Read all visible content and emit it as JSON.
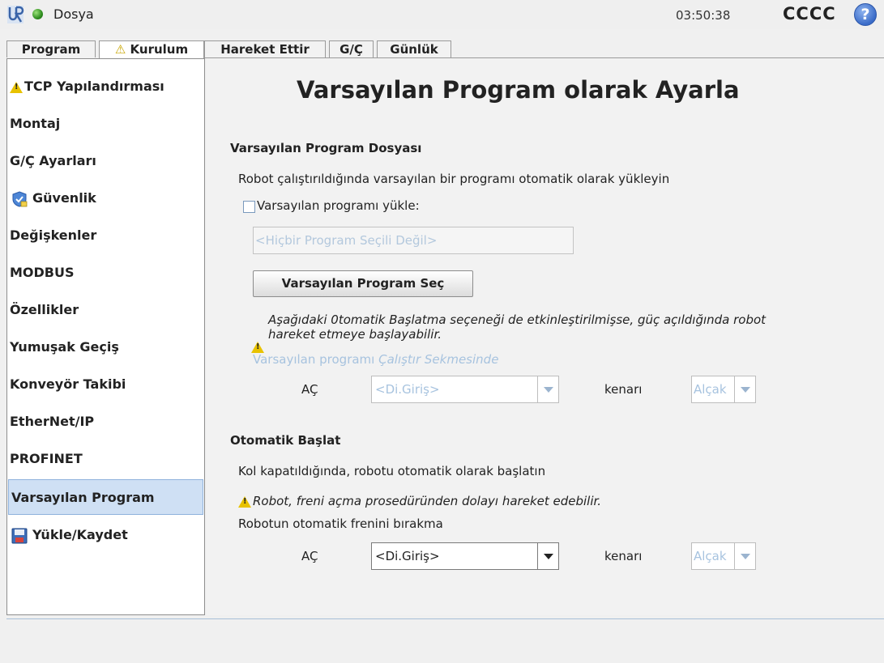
{
  "topbar": {
    "file_menu": "Dosya",
    "time": "03:50:38",
    "robot_name": "CCCC",
    "help_symbol": "?"
  },
  "tabs": [
    {
      "label": "Program",
      "warning": false
    },
    {
      "label": "Kurulum",
      "warning": true,
      "active": true
    },
    {
      "label": "Hareket Ettir",
      "warning": false
    },
    {
      "label": "G/Ç",
      "warning": false
    },
    {
      "label": "Günlük",
      "warning": false
    }
  ],
  "sidebar": {
    "items": [
      {
        "label": "TCP Yapılandırması",
        "icon": "warning-icon"
      },
      {
        "label": "Montaj"
      },
      {
        "label": "G/Ç Ayarları"
      },
      {
        "label": "Güvenlik",
        "icon": "shield-icon"
      },
      {
        "label": "Değişkenler"
      },
      {
        "label": "MODBUS"
      },
      {
        "label": "Özellikler"
      },
      {
        "label": "Yumuşak Geçiş"
      },
      {
        "label": "Konveyör Takibi"
      },
      {
        "label": "EtherNet/IP"
      },
      {
        "label": "PROFINET"
      },
      {
        "label": "Varsayılan Program",
        "selected": true
      },
      {
        "label": "Yükle/Kaydet",
        "icon": "save-icon"
      }
    ]
  },
  "main": {
    "title": "Varsayılan Program olarak Ayarla",
    "default_file": {
      "heading": "Varsayılan Program Dosyası",
      "description": "Robot çalıştırıldığında varsayılan bir programı otomatik olarak yükleyin",
      "checkbox_label": "Varsayılan programı yükle:",
      "checkbox_checked": false,
      "program_field_value": "<Hiçbir Program Seçili Değil>",
      "select_button": "Varsayılan Program Seç",
      "warning_line1": "Aşağıdaki 0tomatik Başlatma seçeneği de etkinleştirilmişse, güç açıldığında robot",
      "warning_line2": "hareket etmeye başlayabilir.",
      "run_tab_prefix": "Varsayılan programı ",
      "run_tab_italic": "Çalıştır Sekmesinde",
      "on_label": "AÇ",
      "input_select": "<Di.Giriş>",
      "edge_label": "kenarı",
      "edge_select": "Alçak"
    },
    "autostart": {
      "heading": "Otomatik Başlat",
      "description": "Kol kapatıldığında, robotu otomatik olarak başlatın",
      "warning": "Robot, freni açma prosedüründen dolayı hareket edebilir.",
      "brake_label": "Robotun otomatik frenini bırakma",
      "on_label": "AÇ",
      "input_select": "<Di.Giriş>",
      "edge_label": "kenarı",
      "edge_select": "Alçak"
    }
  },
  "colors": {
    "accent": "#3a6bc8",
    "selected_bg": "#cfe0f4",
    "warning": "#e8c200",
    "disabled_text": "#a7c3df"
  }
}
